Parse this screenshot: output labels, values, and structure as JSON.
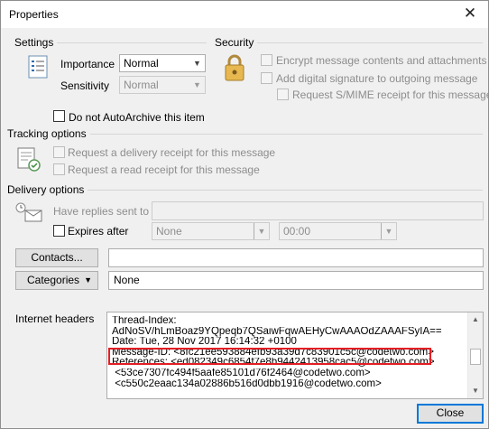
{
  "window": {
    "title": "Properties",
    "close_glyph": "✕"
  },
  "settings": {
    "label": "Settings",
    "importance_label": "Importance",
    "importance_value": "Normal",
    "sensitivity_label": "Sensitivity",
    "sensitivity_value": "Normal"
  },
  "security": {
    "label": "Security",
    "encrypt_label": "Encrypt message contents and attachments",
    "signature_label": "Add digital signature to outgoing message",
    "smime_label": "Request S/MIME receipt for this message"
  },
  "autoarchive_label": "Do not AutoArchive this item",
  "tracking": {
    "label": "Tracking options",
    "delivery_receipt_label": "Request a delivery receipt for this message",
    "read_receipt_label": "Request a read receipt for this message"
  },
  "delivery": {
    "label": "Delivery options",
    "replies_label": "Have replies sent to",
    "replies_value": "",
    "expires_label": "Expires after",
    "expires_date": "None",
    "expires_time": "00:00"
  },
  "contacts": {
    "button_label": "Contacts...",
    "value": ""
  },
  "categories": {
    "button_label": "Categories",
    "value": "None"
  },
  "internet_headers": {
    "label": "Internet headers",
    "lines": [
      "Thread-Index:",
      "AdNoSV/hLmBoaz9YQpeqb7QSaiwFqwAEHyCwAAAOdZAAAFSyIA==",
      "Date: Tue, 28 Nov 2017 16:14:32 +0100",
      "Message-ID: <8fc21ee593884efb93a39d7c83901c5c@codetwo.com>",
      "References: <ed082349c6854f7e8b9442413958cac5@codetwo.com>",
      " <53ce7307fc494f5aafe85101d76f2464@codetwo.com>",
      " <c550c2eaac134a02886b516d0dbb1916@codetwo.com>"
    ]
  },
  "close_button_label": "Close",
  "colors": {
    "highlight": "#e31e24",
    "accent": "#0078d7"
  }
}
